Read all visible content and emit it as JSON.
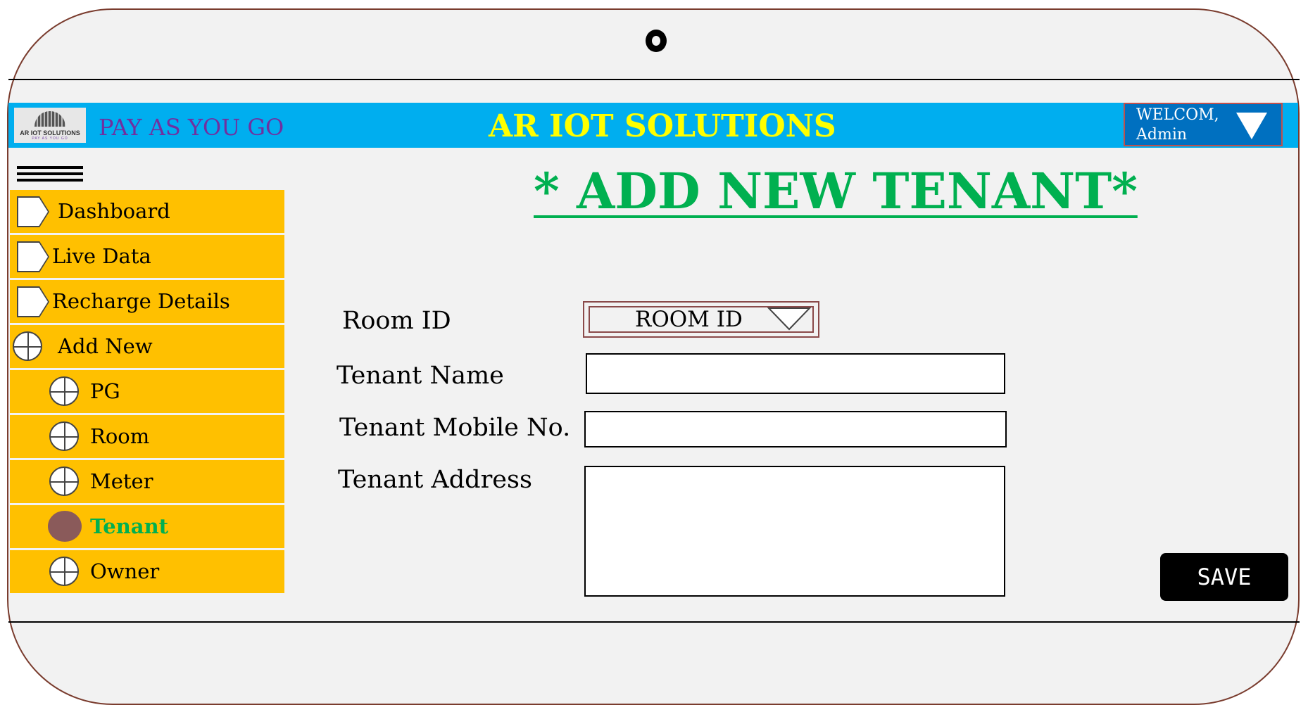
{
  "header": {
    "brand_tagline": "PAY AS YOU GO",
    "brand_name": "AR IOT SOLUTIONS",
    "logo_text": "AR IOT SOLUTIONS",
    "logo_subtext": "PAY AS YOU GO",
    "welcome_line1": "WELCOM,",
    "welcome_line2": "Admin",
    "topbar_color": "#00aeef"
  },
  "sidebar": {
    "items": [
      {
        "label": "Dashboard",
        "icon": "tag-icon"
      },
      {
        "label": "Live Data",
        "icon": "tag-icon"
      },
      {
        "label": "Recharge Details",
        "icon": "tag-icon"
      },
      {
        "label": "Add New",
        "icon": "add-circle-icon"
      },
      {
        "label": "PG",
        "icon": "add-circle-icon"
      },
      {
        "label": "Room",
        "icon": "add-circle-icon"
      },
      {
        "label": "Meter",
        "icon": "add-circle-icon"
      },
      {
        "label": "Tenant",
        "icon": "filled-circle-icon",
        "active": true
      },
      {
        "label": "Owner",
        "icon": "add-circle-icon"
      }
    ],
    "item_color": "#ffc000",
    "active_color": "#00b050"
  },
  "main": {
    "title": "* ADD NEW TENANT*",
    "form": {
      "room_id_label": "Room ID",
      "room_id_value": "ROOM ID",
      "tenant_name_label": "Tenant Name",
      "tenant_name_value": "",
      "tenant_mobile_label": "Tenant Mobile No.",
      "tenant_mobile_value": "",
      "tenant_address_label": "Tenant Address",
      "tenant_address_value": ""
    },
    "save_label": "SAVE"
  }
}
